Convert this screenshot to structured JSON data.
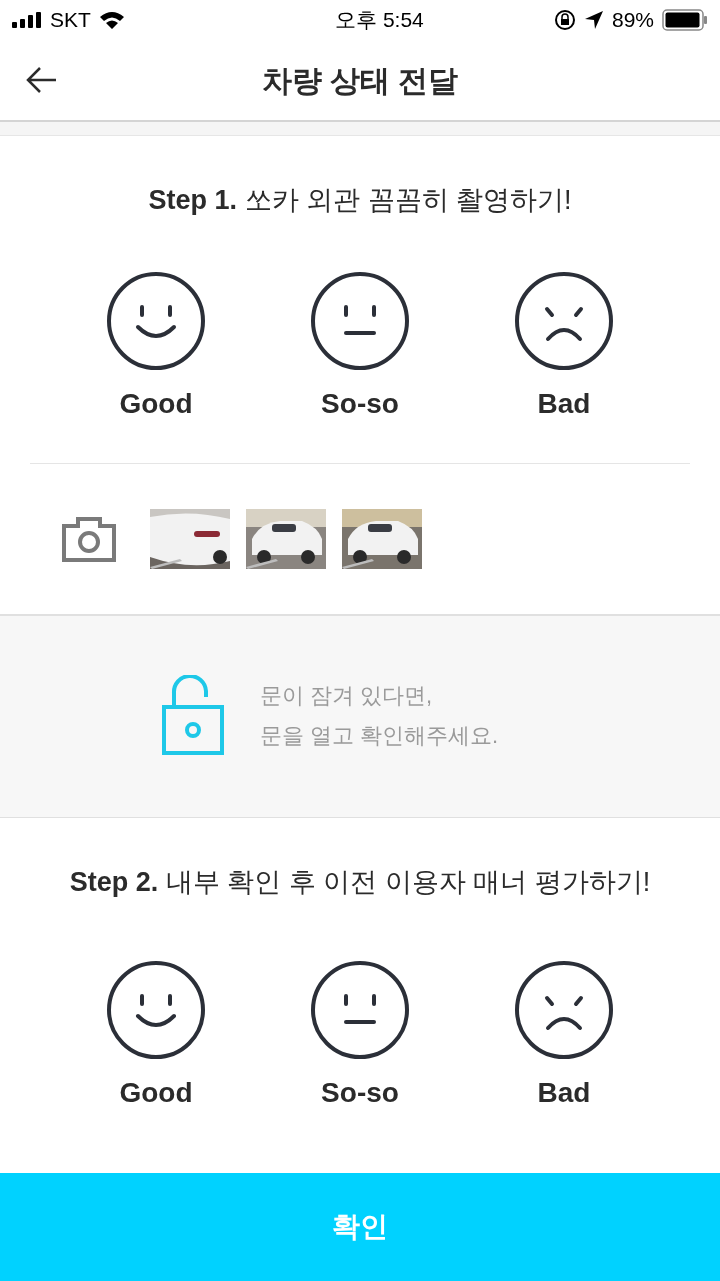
{
  "status_bar": {
    "carrier": "SKT",
    "time": "오후 5:54",
    "battery": "89%"
  },
  "header": {
    "title": "차량 상태 전달"
  },
  "step1": {
    "title": "**Step 1.** 쏘카 외관 꼼꼼히 촬영하기!",
    "ratings": [
      {
        "kind": "good",
        "label": "Good"
      },
      {
        "kind": "soso",
        "label": "So-so"
      },
      {
        "kind": "bad",
        "label": "Bad"
      }
    ]
  },
  "notice": {
    "lines": [
      "문이 잠겨 있다면,",
      "문을 열고 확인해주세요."
    ]
  },
  "step2": {
    "title": "**Step 2.** 내부 확인 후 이전 이용자 매너 평가하기!",
    "ratings": [
      {
        "kind": "good",
        "label": "Good"
      },
      {
        "kind": "soso",
        "label": "So-so"
      },
      {
        "kind": "bad",
        "label": "Bad"
      }
    ]
  },
  "confirm_button": "확인"
}
